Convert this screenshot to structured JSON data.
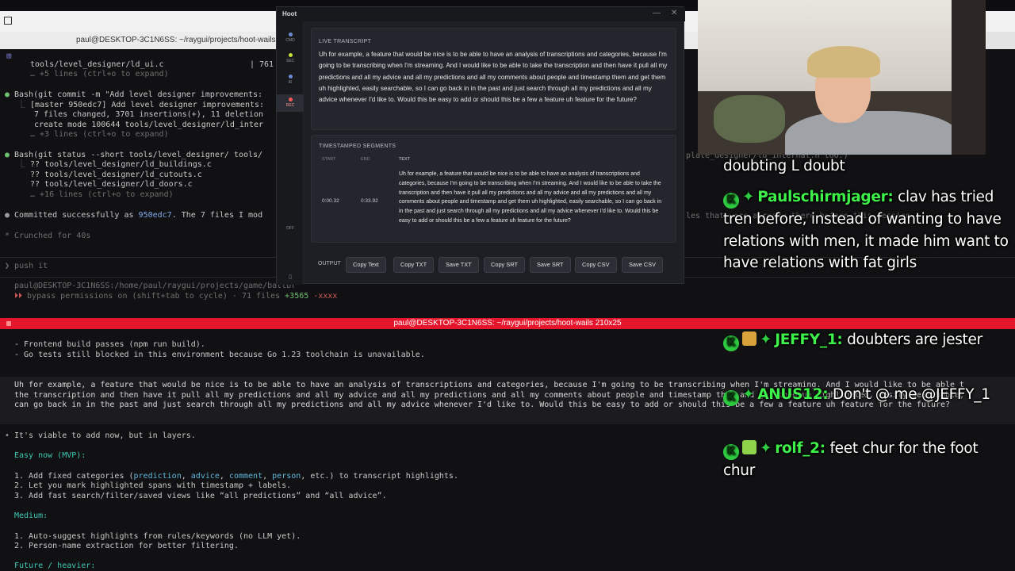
{
  "top_terminal": {
    "title": "paul@DESKTOP-3C1N6SS: ~/raygui/projects/hoot-wails",
    "lines": [
      "tools/level_designer/ld_ui.c                  | 761 ++",
      "… +5 lines (ctrl+o to expand)",
      "Bash(git commit -m \"Add level designer improvements:",
      "[master 950edc7] Add level designer improvements:",
      "7 files changed, 3701 insertions(+), 11 deletion",
      "create mode 100644 tools/level_designer/ld_inter",
      "… +3 lines (ctrl+o to expand)",
      "Bash(git status --short tools/level_designer/ tools/",
      "?? tools/level_designer/ld_buildings.c",
      "?? tools/level_designer/ld_cutouts.c",
      "?? tools/level_designer/ld_doors.c",
      "… +16 lines (ctrl+o to expand)",
      "Committed successfully as",
      "950edc7",
      ". The 7 files I mod",
      "* Crunched for 40s",
      "push it",
      "paul@DESKTOP-3C1N6SS:/home/paul/raygui/projects/game/battbr",
      "bypass permissions on (shift+tab to cycle) · 71 files",
      "+3565",
      "-xxxx"
    ],
    "right_fragment_1": "plate_designer/ld_internal.h too.)",
    "right_fragment_2": "les that were already there before this session."
  },
  "bottom_terminal": {
    "title": "paul@DESKTOP-3C1N6SS: ~/raygui/projects/hoot-wails 210x25",
    "lines_top": [
      "- Frontend build passes (npm run build).",
      "- Go tests still blocked in this environment because Go 1.23 toolchain is unavailable."
    ],
    "user_msg": [
      "Uh for example, a feature that would be nice is to be able to have an analysis of transcriptions and categories, because I'm going to be transcribing when I'm streaming. And I would like to be able t",
      "the transcription and then have it pull all my predictions and all my advice and all my predictions and all my comments about people and timestamp them and get them uh highlighted, easily searchable,",
      "can go back in in the past and just search through all my predictions and all my advice whenever I'd like to. Would this be easy to add or should this be a few a feature uh feature for the future?"
    ],
    "reply_intro": "It's viable to add now, but in layers.",
    "easy_heading": "Easy now (MVP):",
    "easy_items": [
      "1. Add fixed categories (",
      "prediction",
      ", ",
      "advice",
      ", ",
      "comment",
      ", ",
      "person",
      ", etc.) to transcript highlights.",
      "2. Let you mark highlighted spans with timestamp + labels.",
      "3. Add fast search/filter/saved views like “all predictions” and “all advice”."
    ],
    "medium_heading": "Medium:",
    "medium_items": [
      "1. Auto-suggest highlights from rules/keywords (no LLM yet).",
      "2. Person-name extraction for better filtering."
    ],
    "future_heading": "Future / heavier:"
  },
  "hoot": {
    "title": "Hoot",
    "min_icon": "—",
    "close_icon": "✕",
    "rail": [
      {
        "label": "CMD",
        "color": "#6f8bd6"
      },
      {
        "label": "SEC",
        "color": "#c7e23a"
      },
      {
        "label": "AI",
        "color": "#6f8bd6"
      },
      {
        "label": "REC",
        "color": "#ff5a5a"
      }
    ],
    "rail_off": "OFF",
    "live": {
      "label": "LIVE TRANSCRIPT",
      "text": "Uh for example, a feature that would be nice is to be able to have an analysis of transcriptions and categories, because I'm going to be transcribing when I'm streaming. And I would like to be able to take the transcription and then have it pull all my predictions and all my advice and all my predictions and all my comments about people and timestamp them and get them uh highlighted, easily searchable, so I can go back in in the past and just search through all my predictions and all my advice whenever I'd like to. Would this be easy to add or should this be a few a feature uh feature for the future?"
    },
    "segments": {
      "label": "TIMESTAMPED SEGMENTS",
      "col_start": "START",
      "col_end": "END",
      "col_text": "TEXT",
      "row": {
        "start": "0:00.32",
        "end": "0:33.92",
        "text": "Uh for example, a feature that would be nice is to be able to have an analysis of transcriptions and categories, because I'm going to be transcribing when I'm streaming. And I would like to be able to take the transcription and then have it pull all my predictions and all my advice and all my predictions and all my comments about people and timestamp and get them uh highlighted, easily searchable, so I can go back in in the past and just search through all my predictions and all my advice whenever I'd like to. Would this be easy to add or should this be a few a feature uh feature for the future?"
      }
    },
    "output": {
      "label": "OUTPUT",
      "buttons": [
        "Copy Text",
        "Copy TXT",
        "Save TXT",
        "Copy SRT",
        "Save SRT",
        "Copy CSV",
        "Save CSV"
      ]
    }
  },
  "chat": {
    "messages": [
      {
        "user": "",
        "text": "doubting L doubt"
      },
      {
        "user": "Paulschirmjager:",
        "text": "clav has tried tren before, instead of wanting to have relations with men, it made him want to have relations with fat girls"
      },
      {
        "user": "JEFFY_1:",
        "text": "doubters are jester"
      },
      {
        "user": "ANUS12:",
        "text": "Don't @ me @JEFFY_1"
      },
      {
        "user": "rolf_2:",
        "text": "feet chur for the foot chur"
      }
    ],
    "badge_letter": "K"
  }
}
